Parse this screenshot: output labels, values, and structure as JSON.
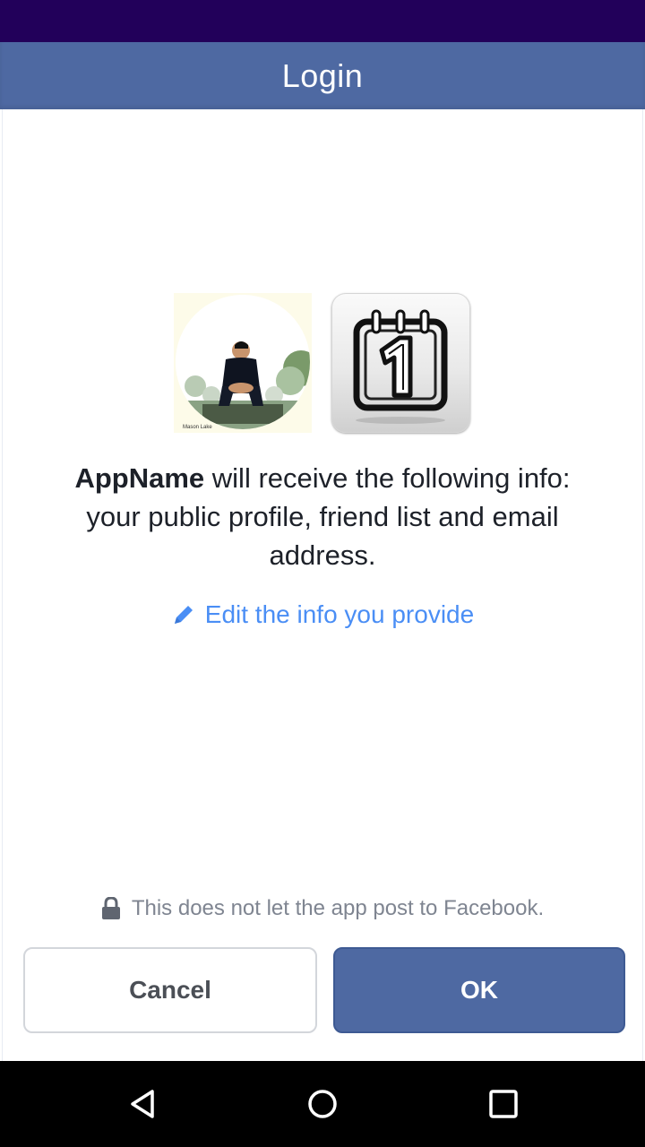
{
  "header": {
    "title": "Login"
  },
  "avatar": {
    "caption": "Mason Lake"
  },
  "message": {
    "app_name": "AppName",
    "body": "will receive the following info: your public profile, friend list and email address."
  },
  "edit_link": {
    "label": "Edit the info you provide",
    "icon": "pencil-icon",
    "color": "#4a8ef5"
  },
  "notice": {
    "text": "This does not let the app post to Facebook.",
    "icon": "lock-icon"
  },
  "buttons": {
    "cancel_label": "Cancel",
    "ok_label": "OK"
  },
  "colors": {
    "brand": "#4e69a2",
    "status_bar": "#22005a",
    "nav_bar": "#000000"
  },
  "nav": {
    "back_icon": "back-triangle-icon",
    "home_icon": "home-circle-icon",
    "recents_icon": "recents-square-icon"
  }
}
